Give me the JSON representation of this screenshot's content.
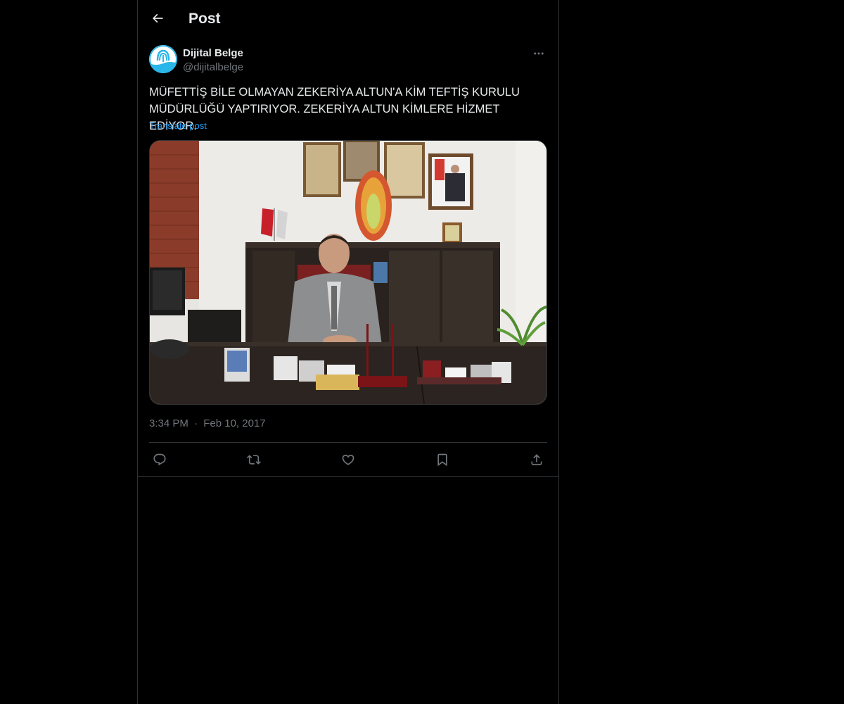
{
  "header": {
    "title": "Post",
    "back_icon": "arrow-left-icon"
  },
  "author": {
    "display_name": "Dijital Belge",
    "handle": "@dijitalbelge",
    "avatar_icon": "logo-avatar-icon",
    "avatar_color": "#29b6e8"
  },
  "post": {
    "text": "MÜFETTİŞ BİLE OLMAYAN ZEKERİYA ALTUN'A KİM TEFTİŞ KURULU\nMÜDÜRLÜĞÜ YAPTIRIYOR. ZEKERİYA ALTUN KİMLERE HİZMET EDİYOR.",
    "translate_label": "Translate post",
    "time": "3:34 PM",
    "separator": "·",
    "date": "Feb 10, 2017"
  },
  "actions": [
    {
      "name": "reply",
      "icon": "reply-icon"
    },
    {
      "name": "repost",
      "icon": "repost-icon"
    },
    {
      "name": "like",
      "icon": "heart-icon"
    },
    {
      "name": "bookmark",
      "icon": "bookmark-icon"
    },
    {
      "name": "share",
      "icon": "share-icon"
    }
  ],
  "colors": {
    "background": "#000000",
    "text": "#e7e9ea",
    "secondary": "#71767b",
    "link": "#1d9bf0",
    "border": "#2f3336"
  }
}
